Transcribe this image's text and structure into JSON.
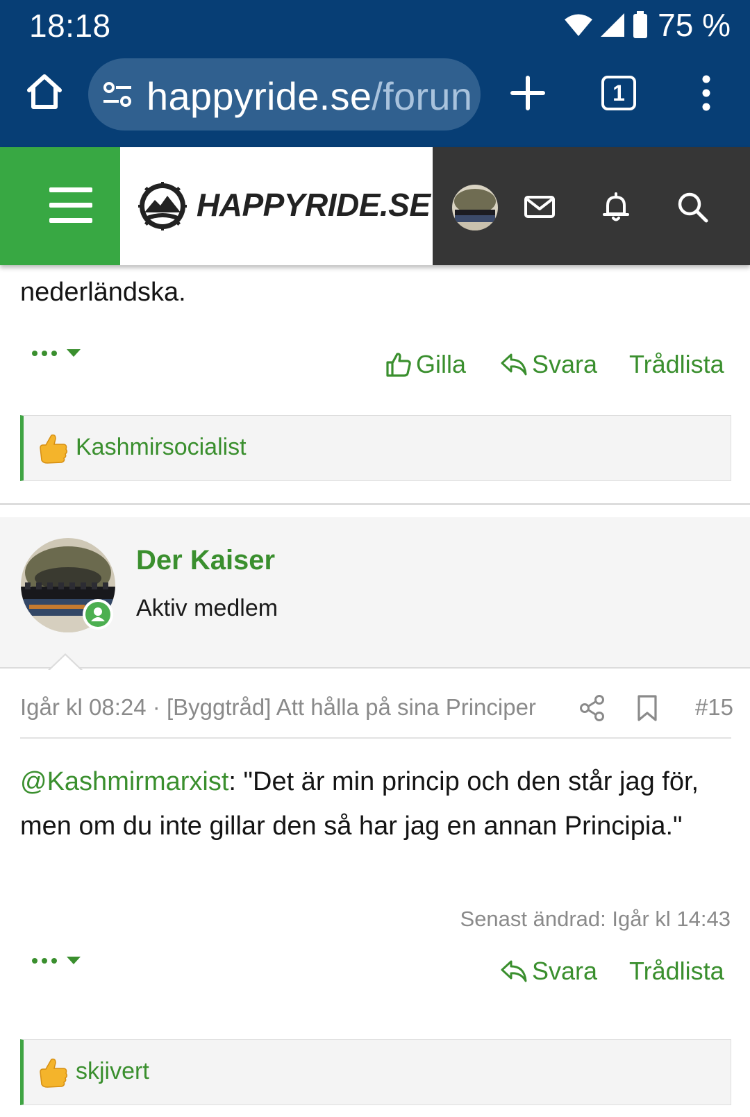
{
  "status_bar": {
    "time": "18:18",
    "battery": "75 %",
    "icons": [
      "wifi-icon",
      "cellular-signal-icon",
      "battery-icon"
    ]
  },
  "browser": {
    "url_host": "happyride.se",
    "url_path": "/forun",
    "tab_count": "1",
    "icons": [
      "home-icon",
      "site-settings-icon",
      "new-tab-plus-icon",
      "tab-switcher-icon",
      "overflow-menu-icon"
    ]
  },
  "site_header": {
    "logo_text": "HAPPYRIDE.SE",
    "icons": [
      "hamburger-menu-icon",
      "logo-emblem-icon",
      "user-avatar",
      "envelope-icon",
      "bell-icon",
      "search-icon"
    ]
  },
  "previous_post": {
    "tail_text": "nederländska.",
    "actions": {
      "like": "Gilla",
      "reply": "Svara",
      "thread_list": "Trådlista"
    },
    "reactions": {
      "emoji": "thumbs-up",
      "users": "Kashmirsocialist"
    }
  },
  "post": {
    "author": {
      "name": "Der Kaiser",
      "title": "Aktiv medlem",
      "online": true
    },
    "meta": {
      "date": "Igår kl 08:24",
      "separator": " · ",
      "thread_title": "[Byggtråd] Att hålla på sina Principer",
      "post_number": "#15"
    },
    "body": {
      "mention": "@Kashmirmarxist",
      "text": ": \"Det är min princip och den står jag för, men om du inte gillar den så har jag en annan Principia.\""
    },
    "edited": "Senast ändrad: Igår kl 14:43",
    "actions": {
      "reply": "Svara",
      "thread_list": "Trådlista"
    },
    "reactions": {
      "emoji": "thumbs-up",
      "users": "skjivert"
    }
  },
  "colors": {
    "browser_bar": "#073e75",
    "url_box": "#30608f",
    "brand_green": "#38a843",
    "link_green": "#3a8f2e",
    "nav_dark": "#363636"
  }
}
